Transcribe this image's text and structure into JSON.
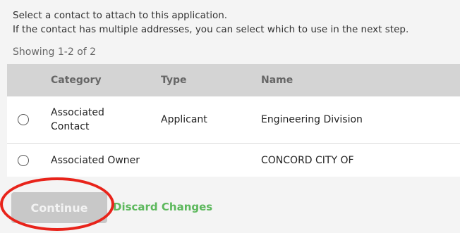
{
  "intro": {
    "line1": "Select a contact to attach to this application.",
    "line2": "If the contact has multiple addresses, you can select which to use in the next step."
  },
  "showing": "Showing 1-2 of 2",
  "table": {
    "headers": {
      "category": "Category",
      "type": "Type",
      "name": "Name"
    },
    "rows": [
      {
        "category_line1": "Associated",
        "category_line2": "Contact",
        "type": "Applicant",
        "name": "Engineering Division",
        "selected": false
      },
      {
        "category_line1": "Associated Owner",
        "category_line2": "",
        "type": "",
        "name": "CONCORD CITY OF",
        "selected": false
      }
    ]
  },
  "actions": {
    "continue_label": "Continue",
    "discard_label": "Discard Changes"
  },
  "colors": {
    "background": "#f4f4f4",
    "header_bg": "#d4d4d4",
    "button_disabled_bg": "#c8c8c8",
    "link_green": "#5cb85c",
    "annotation_red": "#e8231a"
  }
}
